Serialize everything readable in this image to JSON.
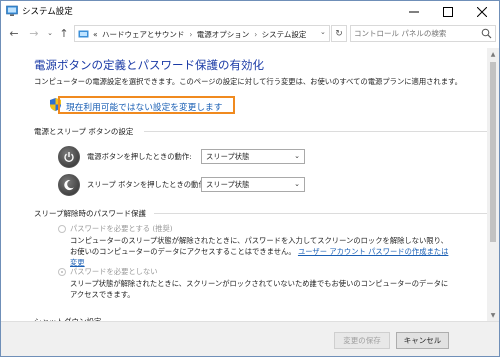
{
  "window": {
    "title": "システム設定"
  },
  "nav": {
    "breadcrumbs": [
      "«",
      "ハードウェアとサウンド",
      "電源オプション",
      "システム設定"
    ],
    "search_placeholder": "コントロール パネルの検索"
  },
  "main": {
    "heading": "電源ボタンの定義とパスワード保護の有効化",
    "description": "コンピューターの電源設定を選択できます。このページの設定に対して行う変更は、お使いのすべての電源プランに適用されます。",
    "change_link": "現在利用可能ではない設定を変更します",
    "section_power": "電源とスリープ ボタンの設定",
    "power_button_label": "電源ボタンを押したときの動作:",
    "power_button_value": "スリープ状態",
    "sleep_button_label": "スリープ ボタンを押したときの動作:",
    "sleep_button_value": "スリープ状態",
    "section_password": "スリープ解除時のパスワード保護",
    "opt1_label": "パスワードを必要とする (推奨)",
    "opt1_desc": "コンピューターのスリープ状態が解除されたときに、パスワードを入力してスクリーンのロックを解除しない限り、お使いのコンピューターのデータにアクセスすることはできません。",
    "opt1_link": "ユーザー アカウント パスワードの作成または変更",
    "opt2_label": "パスワードを必要としない",
    "opt2_desc": "スリープ状態が解除されたときに、スクリーンがロックされていないため誰でもお使いのコンピューターのデータにアクセスできます。",
    "section_shutdown": "シャットダウン設定"
  },
  "footer": {
    "save_label": "変更の保存",
    "cancel_label": "キャンセル"
  },
  "colors": {
    "heading": "#1a3aa6",
    "link": "#1a5fb4",
    "highlight": "#f08a1f"
  }
}
